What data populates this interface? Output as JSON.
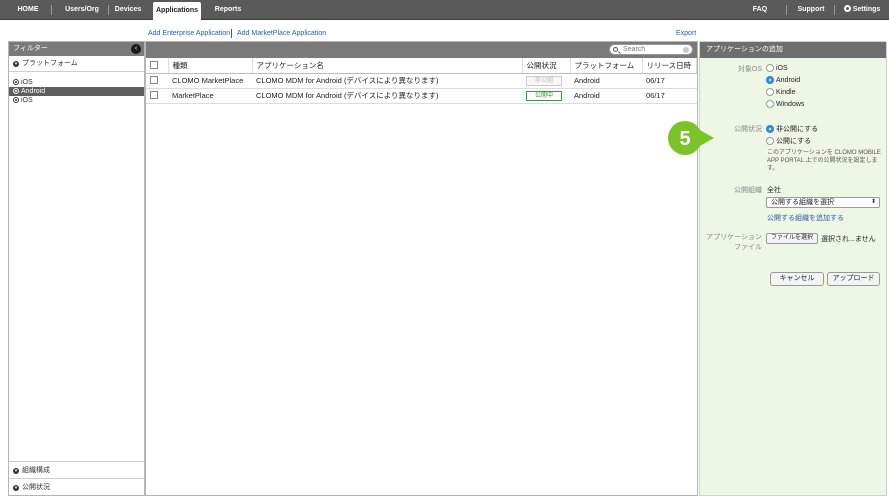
{
  "nav": {
    "home": "HOME",
    "users": "Users/Org",
    "devices": "Devices",
    "applications": "Applications",
    "reports": "Reports",
    "faq": "FAQ",
    "support": "Support",
    "settings": "Settings"
  },
  "sublinks": {
    "add_enterprise": "Add Enterprise Application",
    "add_marketplace": "Add MarketPlace Application",
    "export": "Export"
  },
  "filter": {
    "title": "フィルター",
    "platform_section": "プラットフォーム",
    "platforms": [
      {
        "label": "iOS",
        "selected": false
      },
      {
        "label": "Android",
        "selected": true
      },
      {
        "label": "iOS",
        "selected": false
      }
    ],
    "org_section": "組織構成",
    "status_section": "公開状況"
  },
  "table": {
    "search_placeholder": "Search",
    "headers": {
      "type": "種類",
      "name": "アプリケーション名",
      "status": "公開状況",
      "platform": "プラットフォーム",
      "release": "リリース日時"
    },
    "rows": [
      {
        "type": "CLOMO MarketPlace",
        "name": "CLOMO MDM for Android (デバイスにより異なります)",
        "status": "非公開",
        "status_live": false,
        "platform": "Android",
        "release": "06/17"
      },
      {
        "type": "MarketPlace",
        "name": "CLOMO MDM for Android (デバイスにより異なります)",
        "status": "公開中",
        "status_live": true,
        "platform": "Android",
        "release": "06/17"
      }
    ]
  },
  "panel": {
    "title": "アプリケーションの追加",
    "os_label": "対象OS",
    "os_options": [
      {
        "label": "iOS",
        "selected": false
      },
      {
        "label": "Android",
        "selected": true
      },
      {
        "label": "Kindle",
        "selected": false
      },
      {
        "label": "Windows",
        "selected": false
      }
    ],
    "status_label": "公開状況",
    "status_options": [
      {
        "label": "非公開にする",
        "selected": true
      },
      {
        "label": "公開にする",
        "selected": false
      }
    ],
    "status_note_1": "このアプリケーションを CLOMO MOBILE",
    "status_note_2": "APP PORTAL 上での公開状況を設定しま",
    "status_note_3": "す。",
    "org_label": "公開組織",
    "org_value": "全社",
    "org_select": "公開する組織を選択",
    "org_add_link": "公開する組織を追加する",
    "file_label_1": "アプリケーション",
    "file_label_2": "ファイル",
    "file_button": "ファイルを選択",
    "file_status": "選択され...ません",
    "cancel": "キャンセル",
    "upload": "アップロード"
  },
  "step_number": "5",
  "colors": {
    "nav_bg": "#5a5a5a",
    "step_green": "#7cc22a",
    "panel_bg": "#eef6e6",
    "link_blue": "#2a5da8"
  }
}
